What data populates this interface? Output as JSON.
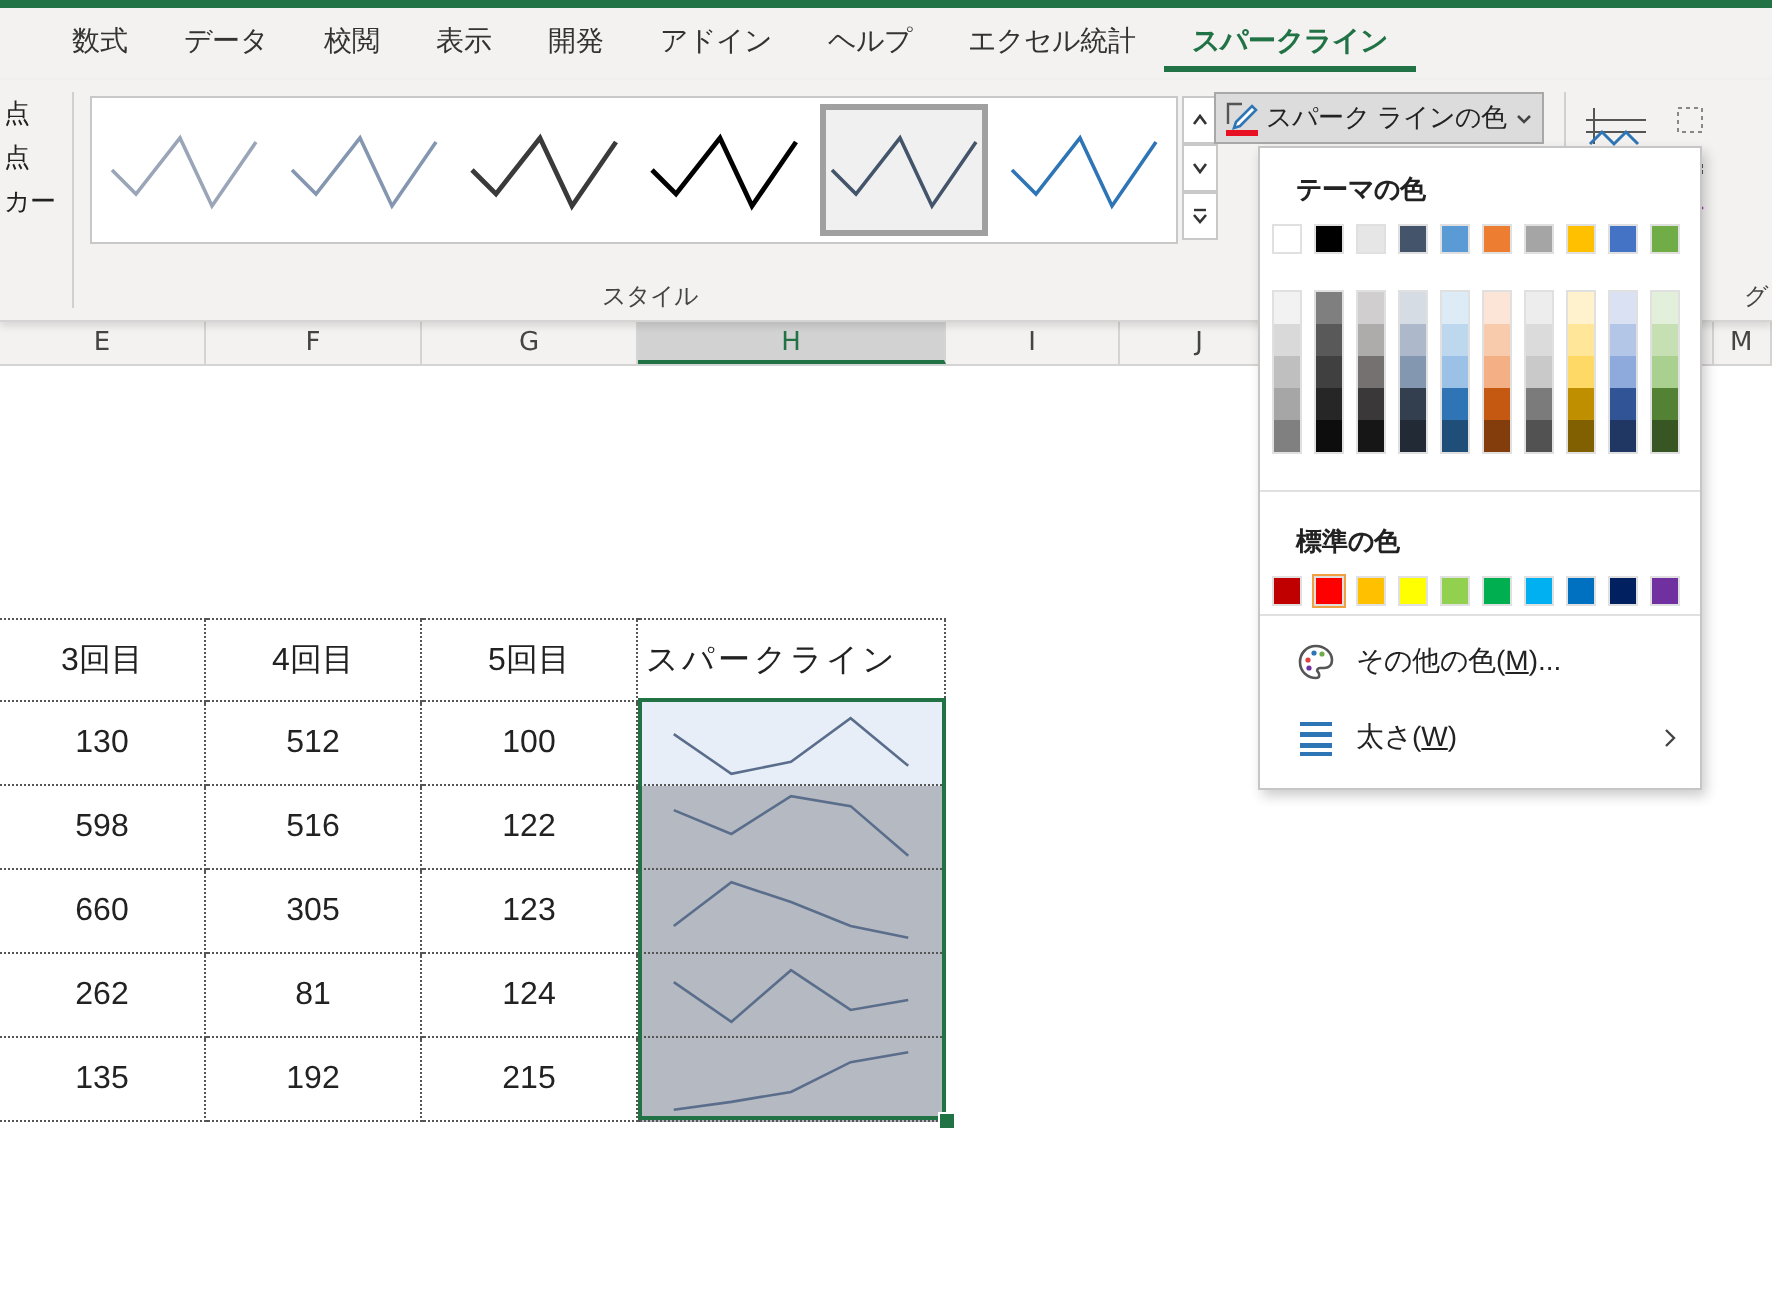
{
  "ribbon": {
    "tabs": [
      {
        "label": "数式",
        "selected": false
      },
      {
        "label": "データ",
        "selected": false
      },
      {
        "label": "校閲",
        "selected": false
      },
      {
        "label": "表示",
        "selected": false
      },
      {
        "label": "開発",
        "selected": false
      },
      {
        "label": "アドイン",
        "selected": false
      },
      {
        "label": "ヘルプ",
        "selected": false
      },
      {
        "label": "エクセル統計",
        "selected": false
      },
      {
        "label": "スパークライン",
        "selected": true
      }
    ],
    "left_labels": [
      "点",
      "点",
      "カー"
    ],
    "styles": [
      {
        "color": "#9aa6b7",
        "selected": false
      },
      {
        "color": "#8496b0",
        "selected": false
      },
      {
        "color": "#3a3a3a",
        "selected": false
      },
      {
        "color": "#000000",
        "selected": false
      },
      {
        "color": "#44546a",
        "selected": true
      },
      {
        "color": "#2e75b6",
        "selected": false
      }
    ],
    "style_group_label": "スタイル",
    "color_button": "スパーク ラインの色",
    "right_group_label": "グ"
  },
  "column_headers": [
    {
      "label": "E",
      "selected": false
    },
    {
      "label": "F",
      "selected": false
    },
    {
      "label": "G",
      "selected": false
    },
    {
      "label": "H",
      "selected": true
    },
    {
      "label": "I",
      "selected": false
    },
    {
      "label": "J",
      "selected": false
    },
    {
      "label": "M",
      "selected": false
    }
  ],
  "table": {
    "columns": [
      "3回目",
      "4回目",
      "5回目",
      "スパークライン"
    ],
    "rows": [
      {
        "cells": [
          "130",
          "512",
          "100"
        ],
        "active": true
      },
      {
        "cells": [
          "598",
          "516",
          "122"
        ],
        "active": false
      },
      {
        "cells": [
          "660",
          "305",
          "123"
        ],
        "active": false
      },
      {
        "cells": [
          "262",
          "81",
          "124"
        ],
        "active": false
      },
      {
        "cells": [
          "135",
          "192",
          "215"
        ],
        "active": false
      }
    ]
  },
  "color_menu": {
    "theme_title": "テーマの色",
    "theme_colors": [
      {
        "color": "#ffffff",
        "shades": [
          {
            "color": "#f2f2f2"
          },
          {
            "color": "#d9d9d9"
          },
          {
            "color": "#bfbfbf"
          },
          {
            "color": "#a6a6a6"
          },
          {
            "color": "#808080"
          }
        ]
      },
      {
        "color": "#000000",
        "shades": [
          {
            "color": "#7f7f7f"
          },
          {
            "color": "#595959"
          },
          {
            "color": "#404040"
          },
          {
            "color": "#262626"
          },
          {
            "color": "#0d0d0d"
          }
        ]
      },
      {
        "color": "#e7e6e6",
        "shades": [
          {
            "color": "#d0cece"
          },
          {
            "color": "#aeabab"
          },
          {
            "color": "#757171"
          },
          {
            "color": "#3a3838"
          },
          {
            "color": "#171616"
          }
        ]
      },
      {
        "color": "#44546a",
        "shades": [
          {
            "color": "#d6dce4"
          },
          {
            "color": "#adb9ca"
          },
          {
            "color": "#8497b0"
          },
          {
            "color": "#333f4f"
          },
          {
            "color": "#222b35"
          }
        ]
      },
      {
        "color": "#5b9bd5",
        "shades": [
          {
            "color": "#ddebf7"
          },
          {
            "color": "#bdd7ee"
          },
          {
            "color": "#9bc2e6"
          },
          {
            "color": "#2f75b5"
          },
          {
            "color": "#1f4e78"
          }
        ]
      },
      {
        "color": "#ed7d31",
        "shades": [
          {
            "color": "#fce4d6"
          },
          {
            "color": "#f8cbad"
          },
          {
            "color": "#f4b084"
          },
          {
            "color": "#c65911"
          },
          {
            "color": "#833c0c"
          }
        ]
      },
      {
        "color": "#a5a5a5",
        "shades": [
          {
            "color": "#ededed"
          },
          {
            "color": "#dbdbdb"
          },
          {
            "color": "#c9c9c9"
          },
          {
            "color": "#7b7b7b"
          },
          {
            "color": "#525252"
          }
        ]
      },
      {
        "color": "#ffc000",
        "shades": [
          {
            "color": "#fff2cc"
          },
          {
            "color": "#ffe699"
          },
          {
            "color": "#ffd966"
          },
          {
            "color": "#bf8f00"
          },
          {
            "color": "#806000"
          }
        ]
      },
      {
        "color": "#4472c4",
        "shades": [
          {
            "color": "#d9e1f2"
          },
          {
            "color": "#b4c6e7"
          },
          {
            "color": "#8ea9db"
          },
          {
            "color": "#305496"
          },
          {
            "color": "#203764"
          }
        ]
      },
      {
        "color": "#70ad47",
        "shades": [
          {
            "color": "#e2efda"
          },
          {
            "color": "#c6e0b4"
          },
          {
            "color": "#a9d08e"
          },
          {
            "color": "#548235"
          },
          {
            "color": "#375623"
          }
        ]
      }
    ],
    "standard_title": "標準の色",
    "standard_colors": [
      {
        "color": "#c00000",
        "selected": false
      },
      {
        "color": "#ff0000",
        "selected": true
      },
      {
        "color": "#ffc000",
        "selected": false
      },
      {
        "color": "#ffff00",
        "selected": false
      },
      {
        "color": "#92d050",
        "selected": false
      },
      {
        "color": "#00b050",
        "selected": false
      },
      {
        "color": "#00b0f0",
        "selected": false
      },
      {
        "color": "#0070c0",
        "selected": false
      },
      {
        "color": "#002060",
        "selected": false
      },
      {
        "color": "#7030a0",
        "selected": false
      }
    ],
    "items": [
      {
        "kind": "palette",
        "label": "その他の色(M)..."
      },
      {
        "kind": "weight",
        "label": "太さ(W)",
        "submenu": true
      }
    ]
  }
}
